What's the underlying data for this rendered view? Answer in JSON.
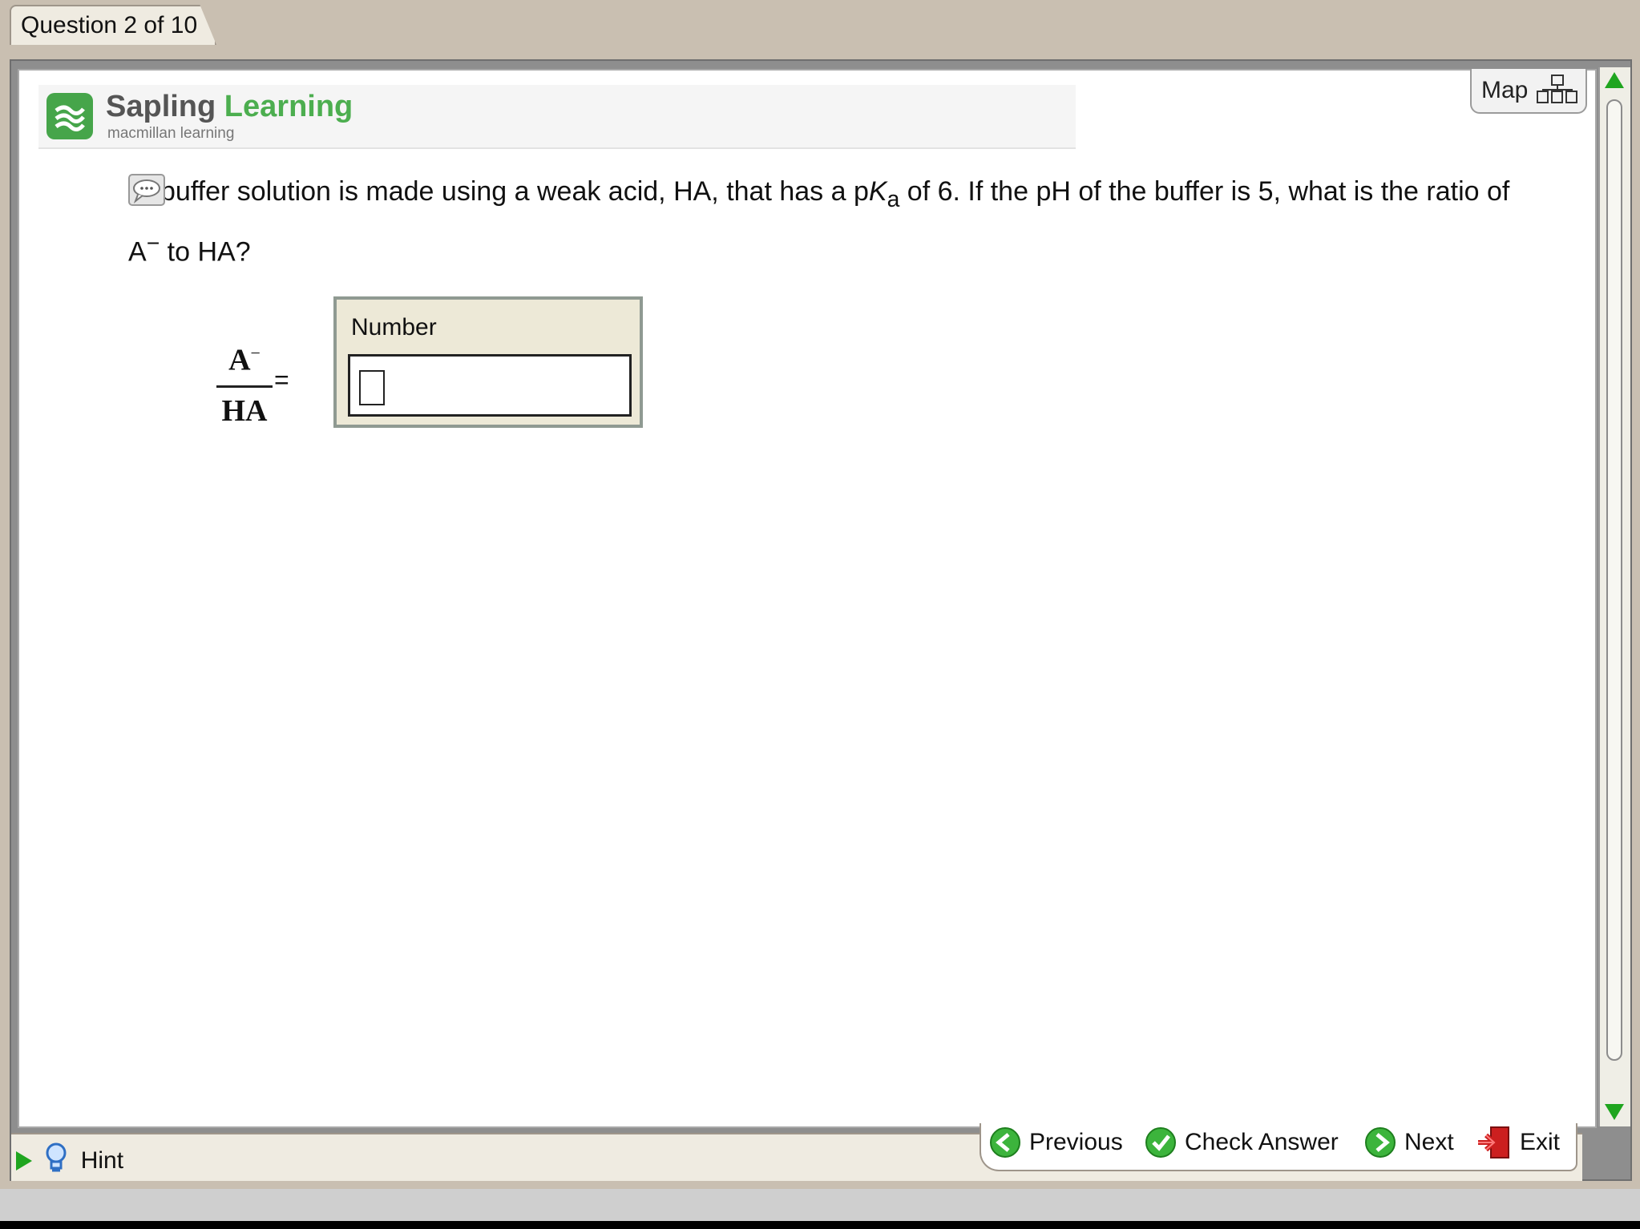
{
  "tab": {
    "label": "Question 2 of 10"
  },
  "brand": {
    "name_part1": "Sapling",
    "name_part2": "Learning",
    "subtitle": "macmillan learning"
  },
  "map": {
    "label": "Map"
  },
  "question": {
    "text_part1": "buffer solution is made using a weak acid, HA, that has a p",
    "pka_symbol": "K",
    "pka_sub": "a",
    "text_part2": " of 6. If the pH of the buffer is 5, what is the ratio of A",
    "minus": "−",
    "text_part3": " to HA?"
  },
  "fraction": {
    "numerator": "A",
    "numerator_sup": "−",
    "denominator": "HA",
    "equals": "="
  },
  "answer": {
    "label": "Number",
    "value": ""
  },
  "hint": {
    "label": "Hint"
  },
  "nav": {
    "previous": "Previous",
    "check": "Check Answer",
    "next": "Next",
    "exit": "Exit"
  },
  "colors": {
    "accent_green": "#1fa51f",
    "brand_green": "#4cae4f",
    "exit_red": "#cc1f1f"
  }
}
